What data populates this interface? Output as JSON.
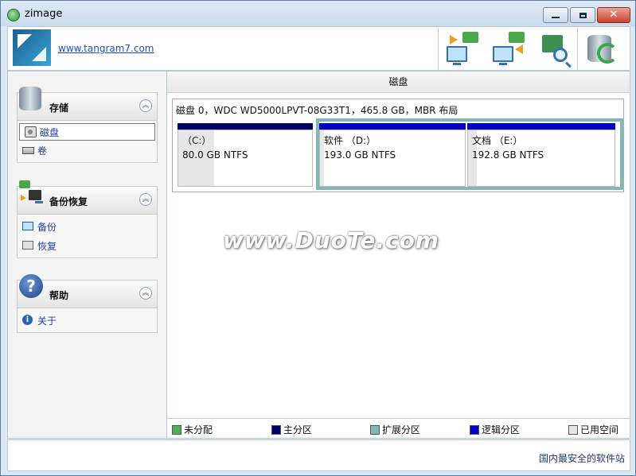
{
  "window": {
    "title": "zimage"
  },
  "header": {
    "site_link": "www.tangram7.com"
  },
  "toolbar": {
    "buttons": [
      {
        "icon": "backup-to-pc-icon"
      },
      {
        "icon": "restore-from-pc-icon"
      },
      {
        "icon": "search-image-icon"
      },
      {
        "icon": "disk-refresh-icon"
      }
    ]
  },
  "sidebar": {
    "groups": [
      {
        "title": "存储",
        "items": [
          {
            "label": "磁盘",
            "selected": true
          },
          {
            "label": "卷"
          }
        ]
      },
      {
        "title": "备份恢复",
        "items": [
          {
            "label": "备份"
          },
          {
            "label": "恢复"
          }
        ]
      },
      {
        "title": "帮助",
        "items": [
          {
            "label": "关于"
          }
        ]
      }
    ]
  },
  "main": {
    "title": "磁盘",
    "disk": {
      "info": "磁盘 0，WDC WD5000LPVT-08G33T1，465.8 GB，MBR 布局",
      "partitions": [
        {
          "label": "（C:）",
          "size": "80.0 GB NTFS",
          "bar_color": "#000066",
          "used_fraction": 0.27
        },
        {
          "label": "软件 （D:）",
          "size": "193.0 GB NTFS",
          "bar_color": "#0000c8",
          "used_fraction": 0.03
        },
        {
          "label": "文档 （E:）",
          "size": "192.8 GB NTFS",
          "bar_color": "#0000c8",
          "used_fraction": 0.06
        }
      ]
    },
    "legend": [
      {
        "label": "未分配",
        "color": "#4caf50"
      },
      {
        "label": "主分区",
        "color": "#000066"
      },
      {
        "label": "扩展分区",
        "color": "#7fb8b8"
      },
      {
        "label": "逻辑分区",
        "color": "#0000c8"
      },
      {
        "label": "已用空间",
        "color": "#e6e6e6"
      }
    ]
  },
  "watermark": {
    "text": "www.DuoTe.com"
  },
  "status": {
    "corner": "国内最安全的软件站"
  }
}
